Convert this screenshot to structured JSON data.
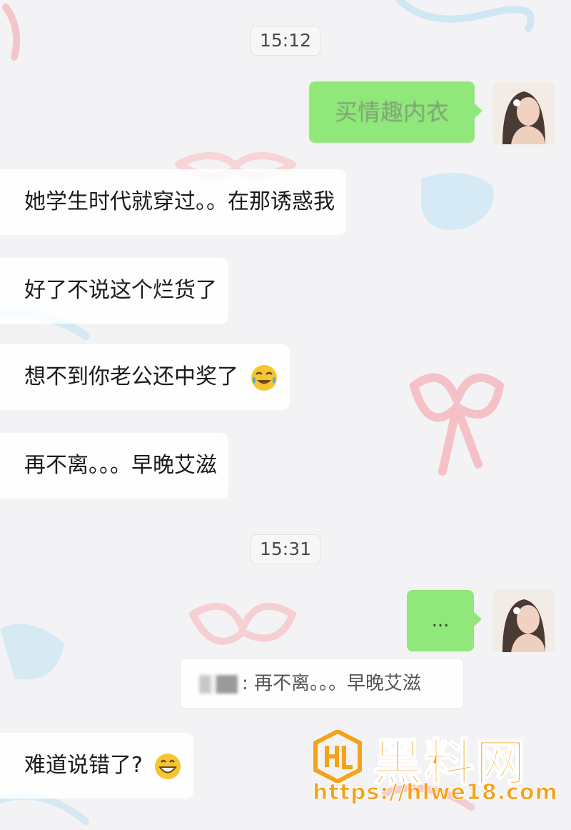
{
  "timestamps": [
    "15:12",
    "15:31"
  ],
  "messages": {
    "out_1": "买情趣内衣",
    "in_1": "她学生时代就穿过。。在那诱惑我",
    "in_2": "好了不说这个烂货了",
    "in_3": "想不到你老公还中奖了",
    "in_4": "再不离。。。早晚艾滋",
    "out_2": "...",
    "quote": ":  再不离。。。早晚艾滋",
    "in_5": "难道说错了?"
  },
  "icons": {
    "emoji_3": "face-with-tears-of-joy-icon",
    "emoji_5": "grinning-face-icon",
    "avatar": "avatar-photo-icon",
    "watermark_logo": "hl-logo-icon"
  },
  "watermark": {
    "title": "黑料网",
    "url": "https://hlwe18.com"
  },
  "colors": {
    "outgoing_bubble": "#8fe879",
    "incoming_bubble": "#ffffff",
    "watermark": "#f5a21b"
  }
}
